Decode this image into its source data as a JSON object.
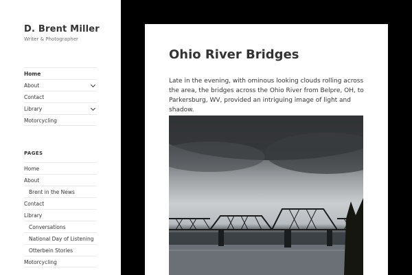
{
  "site": {
    "title": "D. Brent Miller",
    "description": "Writer & Photographer"
  },
  "primary_menu": [
    {
      "label": "Home",
      "current": true
    },
    {
      "label": "About",
      "has_submenu": true
    },
    {
      "label": "Contact"
    },
    {
      "label": "Library",
      "has_submenu": true
    },
    {
      "label": "Motorcycling"
    }
  ],
  "pages_widget": {
    "heading": "PAGES",
    "items": [
      {
        "label": "Home"
      },
      {
        "label": "About"
      },
      {
        "label": "Brent in the News",
        "sub": true
      },
      {
        "label": "Contact"
      },
      {
        "label": "Library"
      },
      {
        "label": "Conversations",
        "sub": true
      },
      {
        "label": "National Day of Listening",
        "sub": true
      },
      {
        "label": "Otterbein Stories",
        "sub": true
      },
      {
        "label": "Motorcycling"
      }
    ]
  },
  "post": {
    "title": "Ohio River Bridges",
    "body": "Late in the evening, with ominous looking clouds rolling across the area, the bridges across the Ohio River from Belpre, OH, to Parkersburg, WV, provided an intriguing image of light and shadow."
  }
}
